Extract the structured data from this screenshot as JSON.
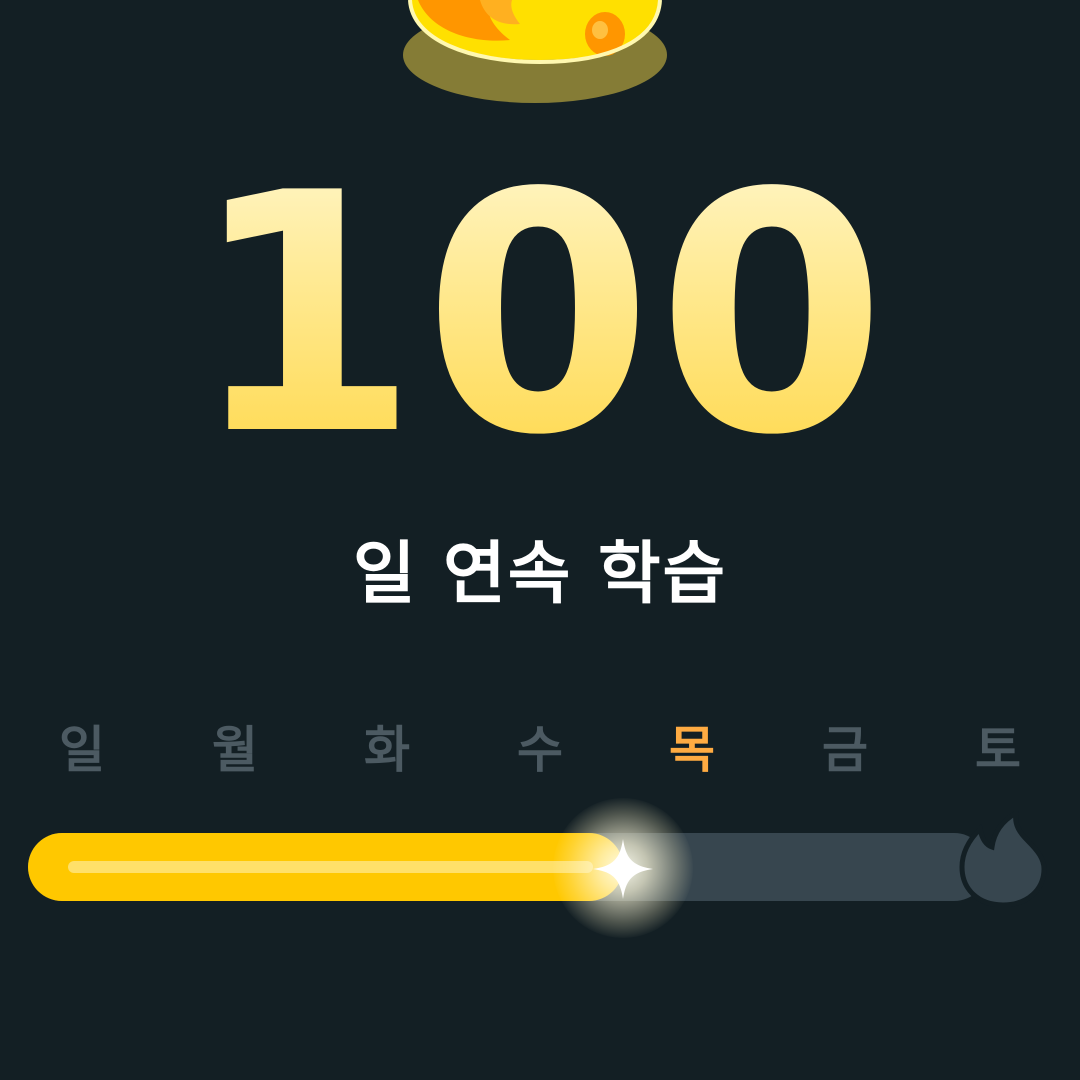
{
  "streak": {
    "count": "100",
    "label": "일 연속 학습"
  },
  "week": {
    "days": [
      "일",
      "월",
      "화",
      "수",
      "목",
      "금",
      "토"
    ],
    "active_index": 4
  },
  "progress": {
    "fraction": 0.62
  },
  "colors": {
    "background": "#131f24",
    "number_gold": "#ffe37a",
    "day_inactive": "#4c5a62",
    "day_active": "#ffab42",
    "bar_fill": "#ffc800",
    "bar_track": "#37464f"
  },
  "icons": {
    "mascot": "flame-mascot-icon",
    "sparkle": "sparkle-icon",
    "end": "flame-icon"
  }
}
